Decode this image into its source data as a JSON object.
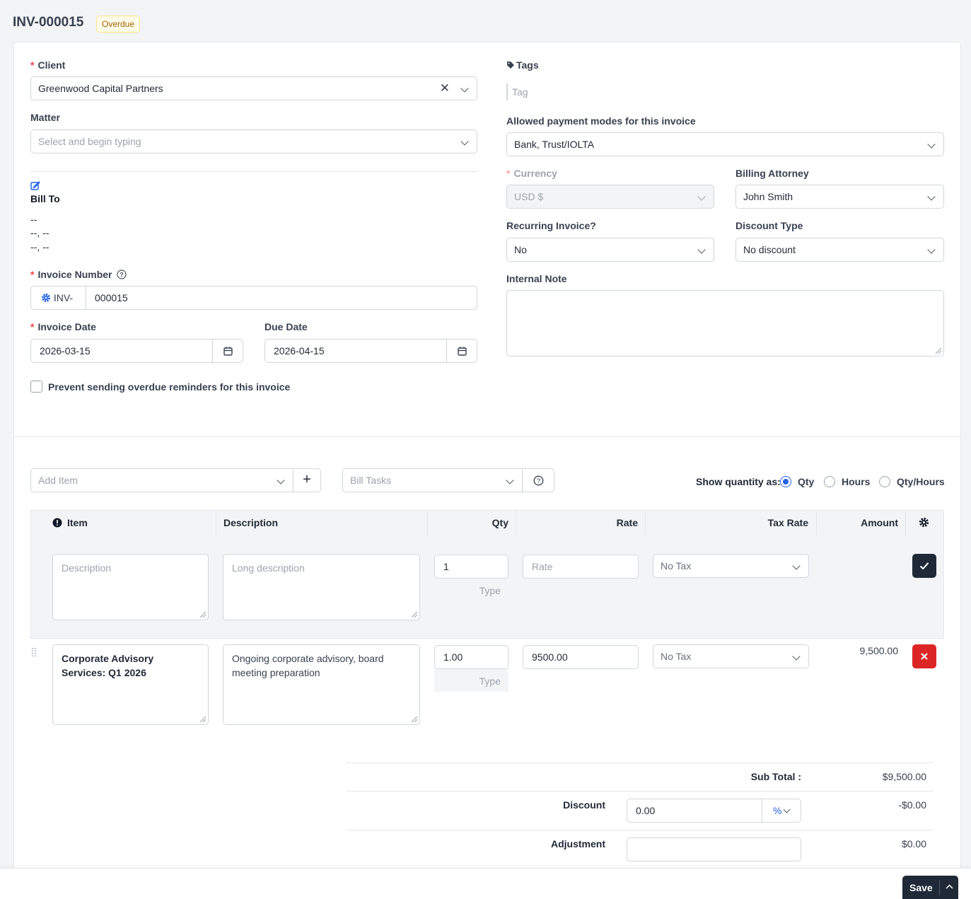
{
  "header": {
    "invoice_id": "INV-000015",
    "status": "Overdue"
  },
  "client": {
    "label": "Client",
    "value": "Greenwood Capital Partners"
  },
  "matter": {
    "label": "Matter",
    "placeholder": "Select and begin typing"
  },
  "bill_to": {
    "label": "Bill To",
    "line1": "--",
    "line2": "--, --",
    "line3": "--, --"
  },
  "invoice_number": {
    "label": "Invoice Number",
    "prefix": "INV-",
    "value": "000015"
  },
  "invoice_date": {
    "label": "Invoice Date",
    "value": "2026-03-15"
  },
  "due_date": {
    "label": "Due Date",
    "value": "2026-04-15"
  },
  "prevent_reminders": {
    "label": "Prevent sending overdue reminders for this invoice",
    "checked": false
  },
  "tags": {
    "label": "Tags",
    "placeholder": "Tag"
  },
  "payment_modes": {
    "label": "Allowed payment modes for this invoice",
    "value": "Bank, Trust/IOLTA"
  },
  "currency": {
    "label": "Currency",
    "value": "USD $"
  },
  "billing_attorney": {
    "label": "Billing Attorney",
    "value": "John Smith"
  },
  "recurring": {
    "label": "Recurring Invoice?",
    "value": "No"
  },
  "discount_type": {
    "label": "Discount Type",
    "value": "No discount"
  },
  "internal_note": {
    "label": "Internal Note",
    "value": ""
  },
  "toolbar": {
    "add_item_placeholder": "Add Item",
    "bill_tasks_placeholder": "Bill Tasks",
    "show_qty_label": "Show quantity as:",
    "qty_options": [
      "Qty",
      "Hours",
      "Qty/Hours"
    ],
    "selected": "Qty"
  },
  "table": {
    "headers": {
      "item": "Item",
      "description": "Description",
      "qty": "Qty",
      "rate": "Rate",
      "tax_rate": "Tax Rate",
      "amount": "Amount"
    },
    "new_row": {
      "item_placeholder": "Description",
      "description_placeholder": "Long description",
      "qty": "1",
      "qty_type": "Type",
      "rate_placeholder": "Rate",
      "tax": "No Tax"
    },
    "rows": [
      {
        "item": "Corporate Advisory Services: Q1 2026",
        "description": "Ongoing corporate advisory, board meeting preparation",
        "qty": "1.00",
        "qty_type": "Type",
        "rate": "9500.00",
        "tax": "No Tax",
        "amount": "9,500.00"
      }
    ]
  },
  "totals": {
    "subtotal_label": "Sub Total :",
    "subtotal": "$9,500.00",
    "discount_label": "Discount",
    "discount_value": "0.00",
    "discount_unit": "%",
    "discount_amount": "-$0.00",
    "adjustment_label": "Adjustment",
    "adjustment_value": "",
    "adjustment_amount": "$0.00"
  },
  "footer": {
    "save_label": "Save"
  },
  "colors": {
    "required": "#ef4444",
    "accent": "#2563eb",
    "danger": "#dc2626",
    "dark": "#1f2937",
    "badge_text": "#a16207"
  }
}
